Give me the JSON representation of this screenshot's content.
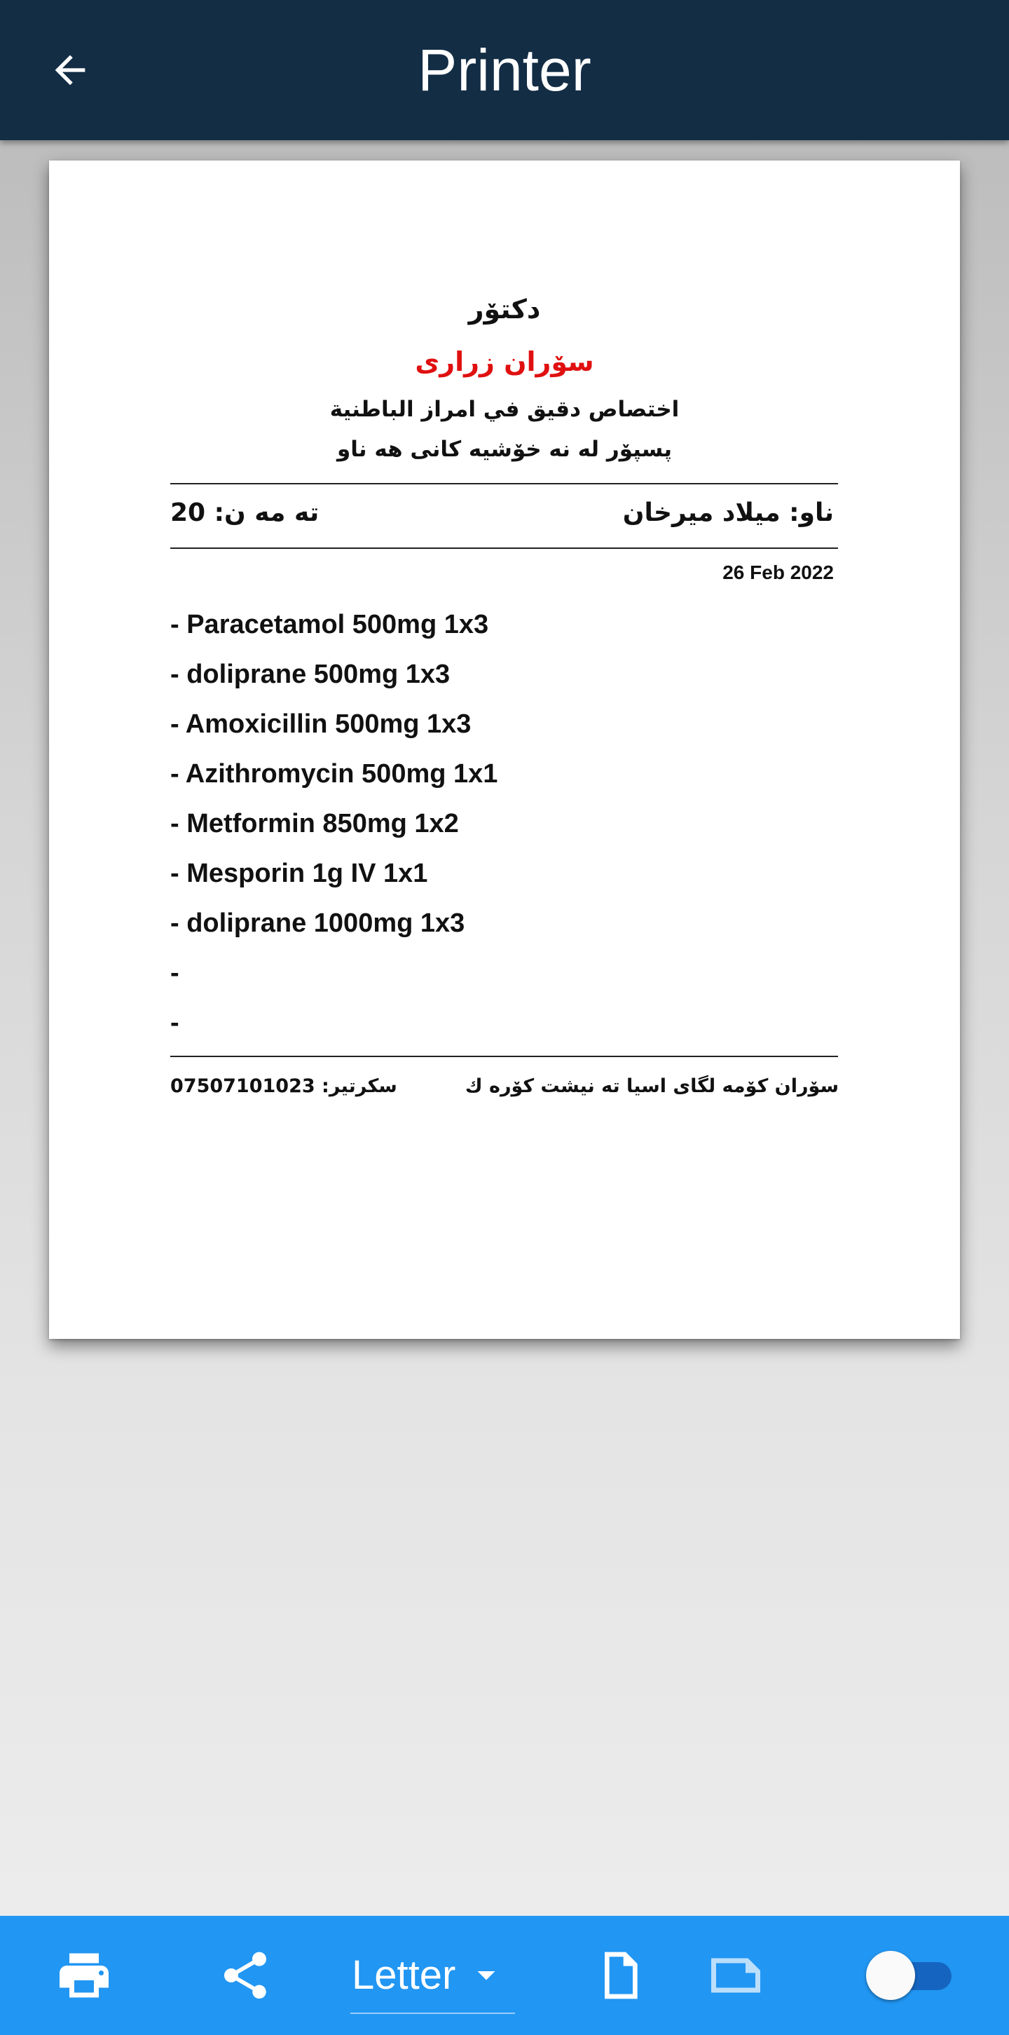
{
  "appbar": {
    "title": "Printer"
  },
  "document": {
    "doctor_label": "دکتۆر",
    "doctor_name": "سۆران زراری",
    "specialty_ar": "اختصاص دقيق في امراز الباطنية",
    "specialty_ku": "پسپۆر له نه خۆشیه كانی هه ناو",
    "patient_name": "ناو:  میلاد میرخان",
    "age": "ته مه ن: 20",
    "date": "26 Feb 2022",
    "medications": [
      "- Paracetamol 500mg 1x3",
      "- doliprane 500mg 1x3",
      "- Amoxicillin 500mg 1x3",
      "- Azithromycin 500mg 1x1",
      "- Metformin 850mg 1x2",
      "- Mesporin 1g IV 1x1",
      "- doliprane 1000mg 1x3",
      "-",
      "-"
    ],
    "footer_address": "سۆران كۆمه لگای اسیا  ته نیشت كۆره ك",
    "footer_secretary": "سكرتير: 07507101023"
  },
  "bottombar": {
    "paper_size": "Letter",
    "icons": [
      "print-icon",
      "share-icon",
      "portrait-orientation-icon",
      "landscape-orientation-icon"
    ],
    "toggle_on": true
  },
  "colors": {
    "appbar": "#132d45",
    "bottombar": "#2196f3",
    "doctor_name": "#e01010"
  }
}
